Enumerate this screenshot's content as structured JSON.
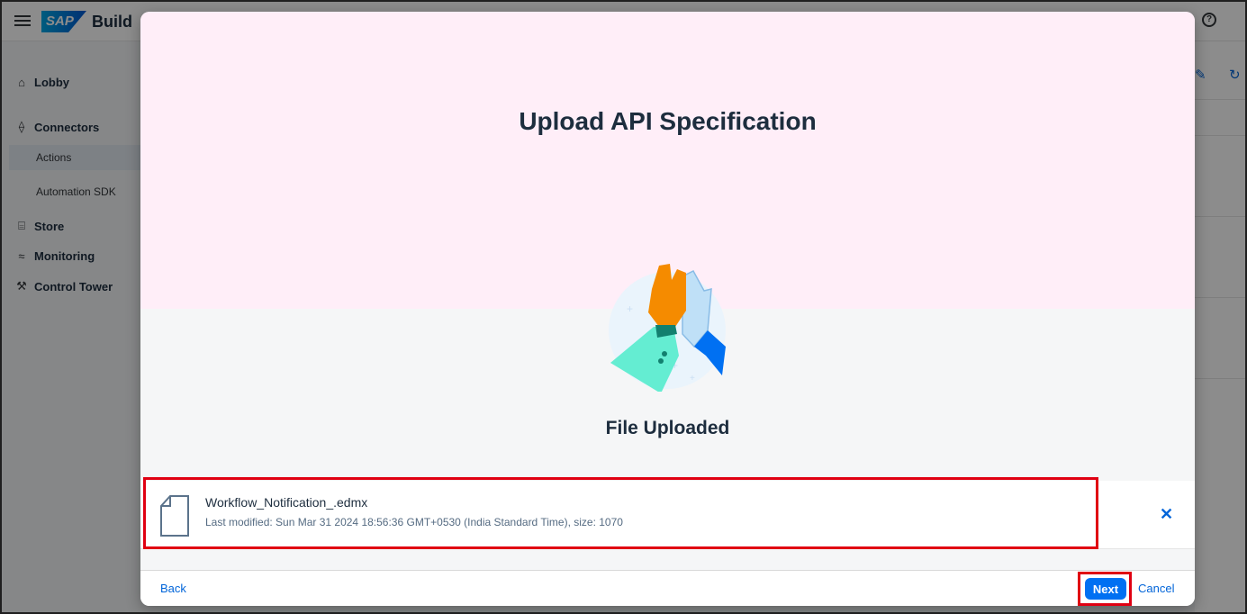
{
  "shell": {
    "logo": "SAP",
    "brand": "Build",
    "help_glyph": "?"
  },
  "sidebar": {
    "items": [
      {
        "label": "Lobby",
        "icon": "home-icon"
      },
      {
        "label": "Connectors",
        "icon": "connector-icon"
      },
      {
        "label": "Actions",
        "sub": true,
        "active": true
      },
      {
        "label": "Automation SDK",
        "sub": true
      },
      {
        "label": "Store",
        "icon": "store-icon"
      },
      {
        "label": "Monitoring",
        "icon": "monitoring-icon"
      },
      {
        "label": "Control Tower",
        "icon": "wrench-icon"
      }
    ]
  },
  "dialog": {
    "title": "Upload API Specification",
    "status": "File Uploaded",
    "file": {
      "name": "Workflow_Notification_.edmx",
      "meta": "Last modified: Sun Mar 31 2024 18:56:36 GMT+0530 (India Standard Time), size: 1070"
    },
    "remove_glyph": "✕",
    "footer": {
      "back_label": "Back",
      "next_label": "Next",
      "cancel_label": "Cancel"
    }
  },
  "colors": {
    "accent": "#0070f2",
    "link": "#0064d9",
    "highlight": "#e00012",
    "dialog_top": "#ffeef8"
  }
}
